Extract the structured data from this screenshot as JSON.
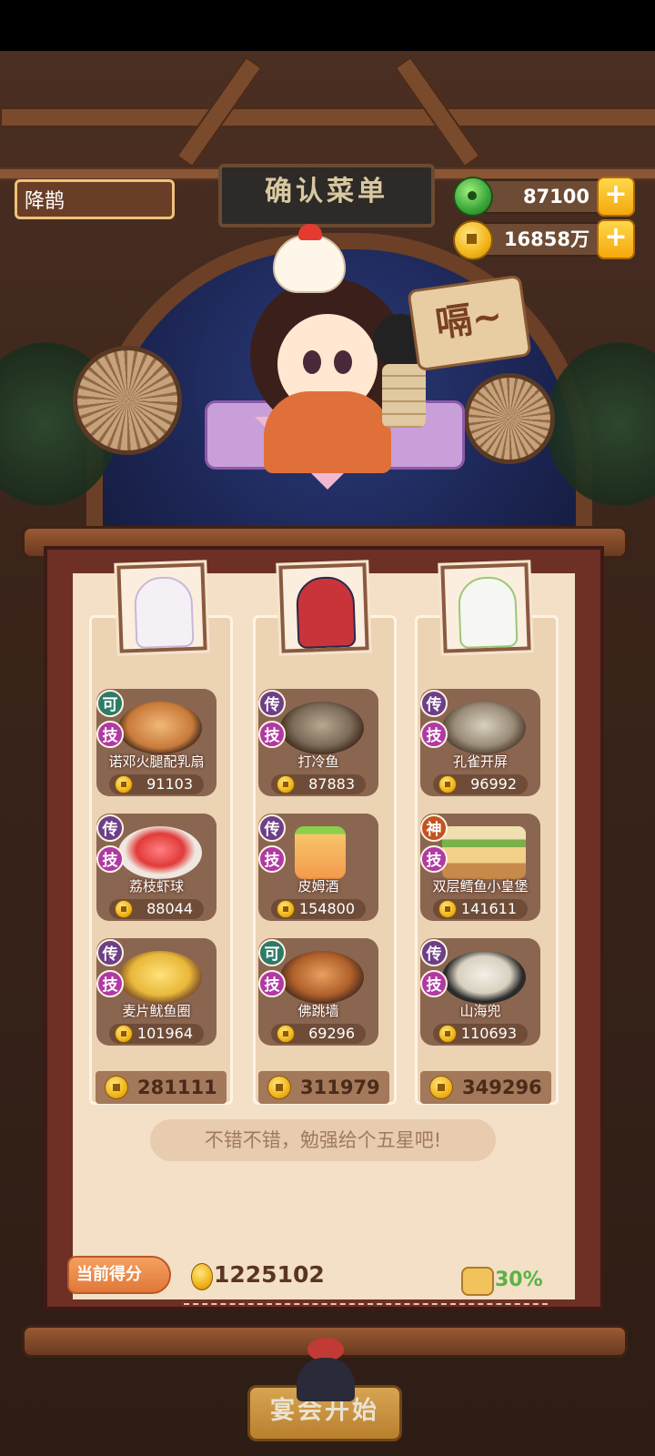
{
  "header": {
    "player_name": "降鹊",
    "sign_title": "确认菜单",
    "speech": "嗝~"
  },
  "currency": {
    "jade": "87100",
    "coins": "16858万",
    "plus": "+"
  },
  "columns": [
    {
      "dishes": [
        {
          "rarity": "可",
          "skill": "技",
          "name": "诺邓火腿配乳扇",
          "price": "91103"
        },
        {
          "rarity": "传",
          "skill": "技",
          "name": "荔枝虾球",
          "price": "88044"
        },
        {
          "rarity": "传",
          "skill": "技",
          "name": "麦片鱿鱼圈",
          "price": "101964"
        }
      ],
      "total": "281111"
    },
    {
      "dishes": [
        {
          "rarity": "传",
          "skill": "技",
          "name": "打冷鱼",
          "price": "87883"
        },
        {
          "rarity": "传",
          "skill": "技",
          "name": "皮姆酒",
          "price": "154800"
        },
        {
          "rarity": "可",
          "skill": "技",
          "name": "佛跳墙",
          "price": "69296"
        }
      ],
      "total": "311979"
    },
    {
      "dishes": [
        {
          "rarity": "传",
          "skill": "技",
          "name": "孔雀开屏",
          "price": "96992"
        },
        {
          "rarity": "神",
          "skill": "技",
          "name": "双层鳕鱼小皇堡",
          "price": "141611"
        },
        {
          "rarity": "传",
          "skill": "技",
          "name": "山海兜",
          "price": "110693"
        }
      ],
      "total": "349296"
    }
  ],
  "comment": "不错不错，勉强给个五星吧!",
  "score": {
    "label": "当前得分",
    "value": "1225102",
    "bonus": "30%"
  },
  "start_button": "宴会开始",
  "colors": {
    "legend_badge": "#6e3f86",
    "common_badge": "#2f7a66",
    "divine_badge": "#c45320",
    "skill_badge": "#b03aa4",
    "bonus_green": "#59b344"
  }
}
